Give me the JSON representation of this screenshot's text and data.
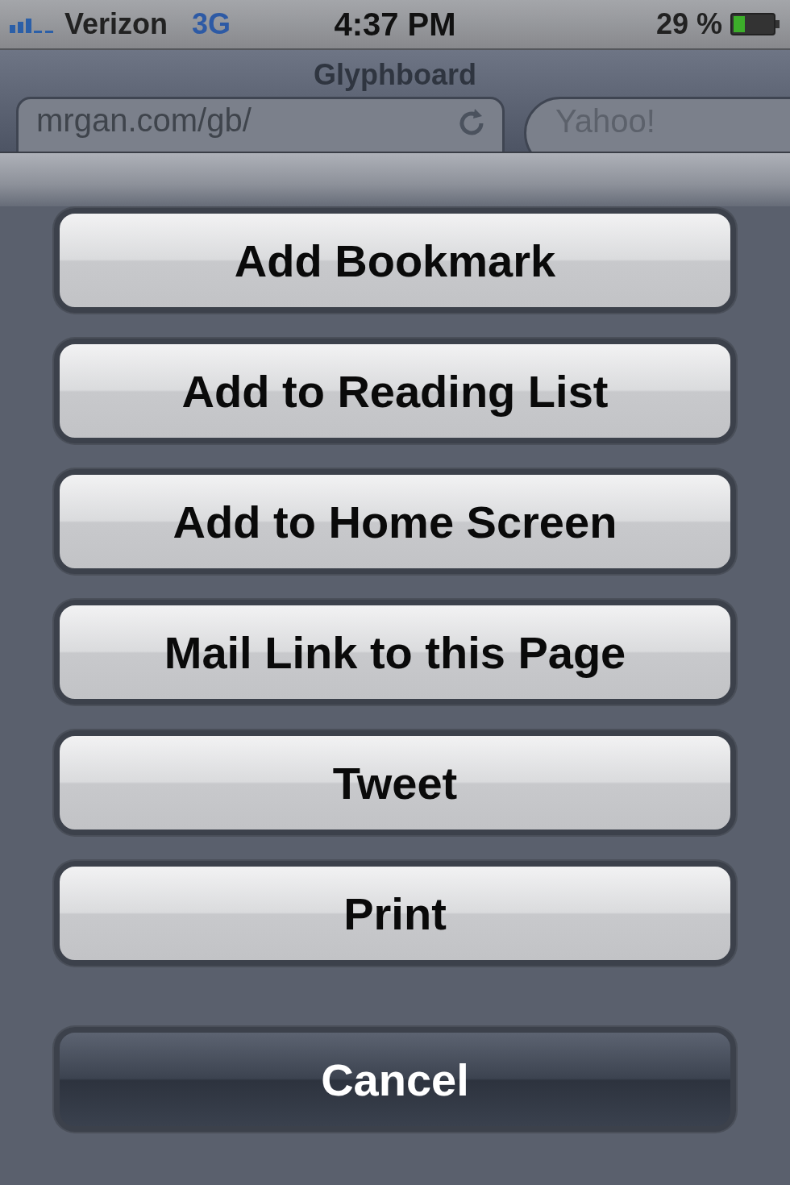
{
  "status_bar": {
    "carrier": "Verizon",
    "network": "3G",
    "time": "4:37 PM",
    "battery": "29 %"
  },
  "browser": {
    "title": "Glyphboard",
    "address": "mrgan.com/gb/",
    "search": {
      "placeholder": "Yahoo!"
    }
  },
  "actions": [
    {
      "label": "Add Bookmark",
      "kind": "default"
    },
    {
      "label": "Add to Reading List",
      "kind": "default"
    },
    {
      "label": "Add to Home Screen",
      "kind": "default"
    },
    {
      "label": "Mail Link to this Page",
      "kind": "default"
    },
    {
      "label": "Tweet",
      "kind": "default"
    },
    {
      "label": "Print",
      "kind": "default"
    },
    {
      "label": "Cancel",
      "kind": "cancel"
    }
  ]
}
